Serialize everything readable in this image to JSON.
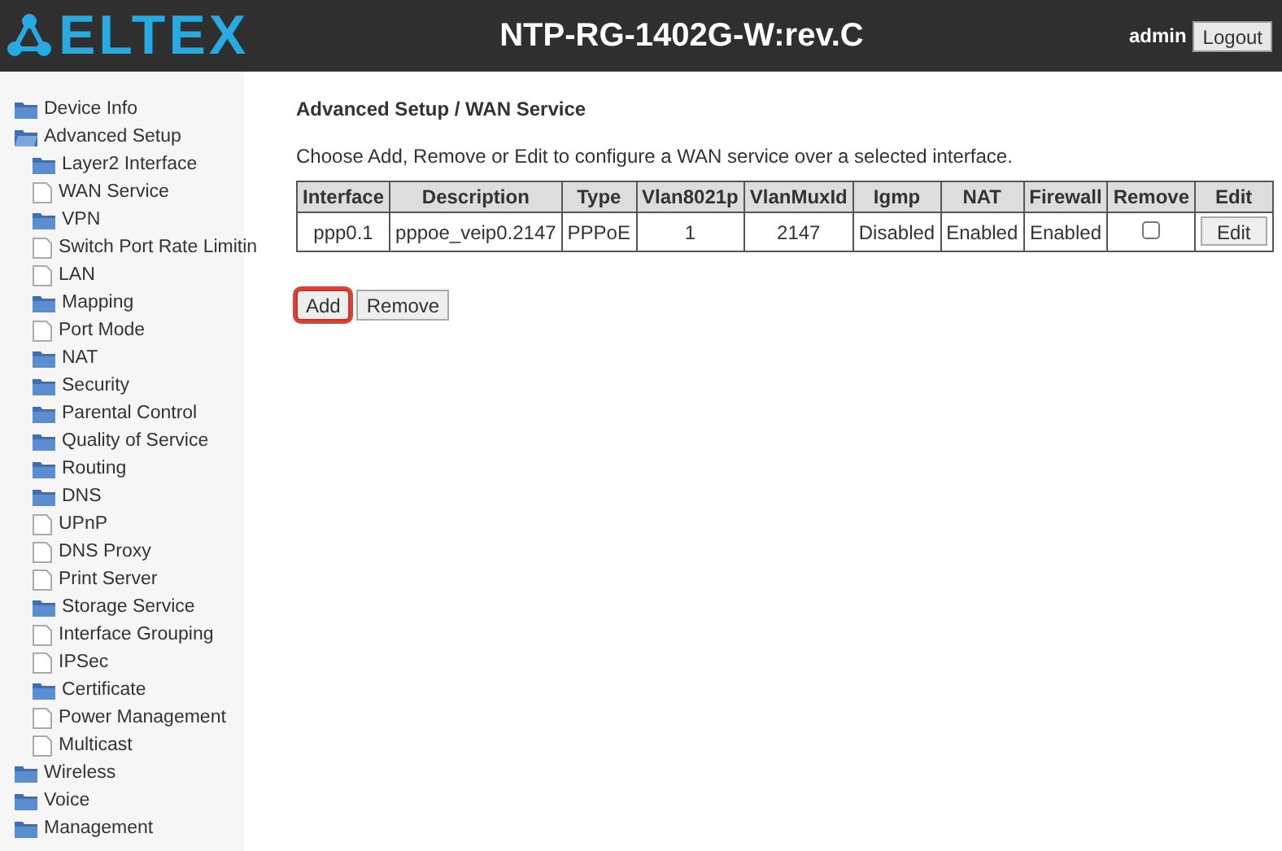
{
  "header": {
    "logo": "ELTEX",
    "title": "NTP-RG-1402G-W:rev.C",
    "user": "admin",
    "logout": "Logout"
  },
  "sidebar": {
    "items": [
      {
        "label": "Device Info",
        "kind": "folder"
      },
      {
        "label": "Advanced Setup",
        "kind": "folder",
        "expanded": true,
        "children": [
          {
            "label": "Layer2 Interface",
            "kind": "folder"
          },
          {
            "label": "WAN Service",
            "kind": "page"
          },
          {
            "label": "VPN",
            "kind": "folder"
          },
          {
            "label": "Switch Port Rate Limitin",
            "kind": "page"
          },
          {
            "label": "LAN",
            "kind": "page"
          },
          {
            "label": "Mapping",
            "kind": "folder"
          },
          {
            "label": "Port Mode",
            "kind": "page"
          },
          {
            "label": "NAT",
            "kind": "folder"
          },
          {
            "label": "Security",
            "kind": "folder"
          },
          {
            "label": "Parental Control",
            "kind": "folder"
          },
          {
            "label": "Quality of Service",
            "kind": "folder"
          },
          {
            "label": "Routing",
            "kind": "folder"
          },
          {
            "label": "DNS",
            "kind": "folder"
          },
          {
            "label": "UPnP",
            "kind": "page"
          },
          {
            "label": "DNS Proxy",
            "kind": "page"
          },
          {
            "label": "Print Server",
            "kind": "page"
          },
          {
            "label": "Storage Service",
            "kind": "folder"
          },
          {
            "label": "Interface Grouping",
            "kind": "page"
          },
          {
            "label": "IPSec",
            "kind": "page"
          },
          {
            "label": "Certificate",
            "kind": "folder"
          },
          {
            "label": "Power Management",
            "kind": "page"
          },
          {
            "label": "Multicast",
            "kind": "page"
          }
        ]
      },
      {
        "label": "Wireless",
        "kind": "folder"
      },
      {
        "label": "Voice",
        "kind": "folder"
      },
      {
        "label": "Management",
        "kind": "folder"
      }
    ]
  },
  "main": {
    "heading": "Advanced Setup / WAN Service",
    "intro": "Choose Add, Remove or Edit to configure a WAN service over a selected interface.",
    "table": {
      "columns": [
        "Interface",
        "Description",
        "Type",
        "Vlan8021p",
        "VlanMuxId",
        "Igmp",
        "NAT",
        "Firewall",
        "Remove",
        "Edit"
      ],
      "rows": [
        {
          "cells": [
            "ppp0.1",
            "pppoe_veip0.2147",
            "PPPoE",
            "1",
            "2147",
            "Disabled",
            "Enabled",
            "Enabled"
          ],
          "remove_checked": false,
          "edit": "Edit"
        }
      ]
    },
    "buttons": [
      {
        "label": "Add",
        "highlighted": true
      },
      {
        "label": "Remove",
        "highlighted": false
      }
    ]
  }
}
